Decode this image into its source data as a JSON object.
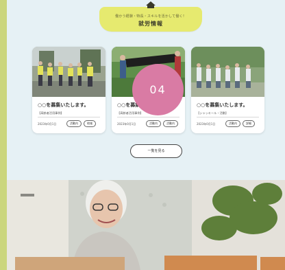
{
  "heading": {
    "subtitle": "働かう経験・特長・スキルを活かして働く！",
    "title": "就労情報"
  },
  "cards": [
    {
      "title": "○○を募集いたします。",
      "tag": "【高齢者活用事例】",
      "date": "2023年0月1日",
      "chips": [
        "活動内",
        "地域"
      ]
    },
    {
      "title": "○○を募集いたします。",
      "tag": "【高齢者活用事例】",
      "date": "2023年0月1日",
      "chips": [
        "活動内",
        "活動内"
      ]
    },
    {
      "title": "○○を募集いたします。",
      "tag": "【シャッキール・活動】",
      "date": "2023年0月1日",
      "chips": [
        "活動内",
        "詳細"
      ]
    }
  ],
  "badge": {
    "label": "04"
  },
  "more_button": {
    "label": "一覧を見る"
  }
}
